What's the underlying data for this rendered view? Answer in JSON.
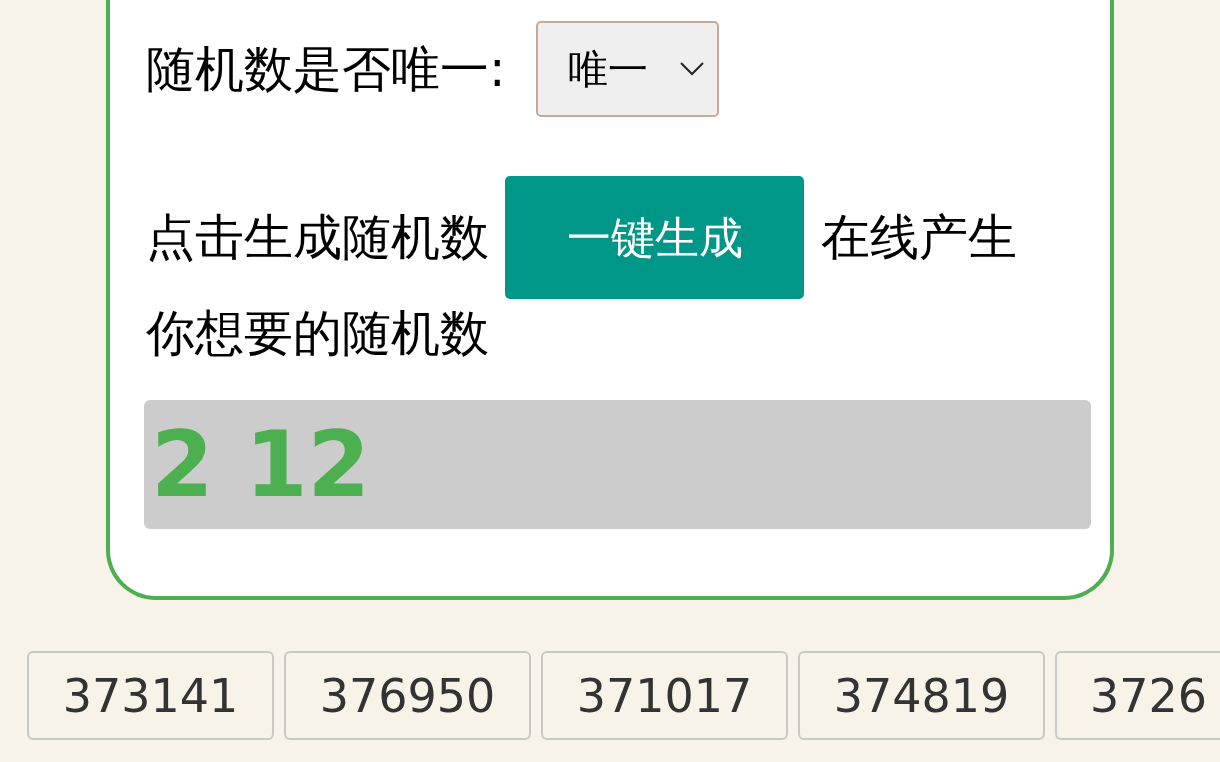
{
  "unique_setting": {
    "label": "随机数是否唯一:",
    "select": {
      "value": "唯一"
    }
  },
  "generate": {
    "prefix": "点击生成随机数",
    "button": "一键生成",
    "suffix_lines": [
      "在线产生",
      "你想要的随机数"
    ]
  },
  "result": {
    "value": "2 12"
  },
  "history": [
    "373141",
    "376950",
    "371017",
    "374819",
    "3726"
  ]
}
